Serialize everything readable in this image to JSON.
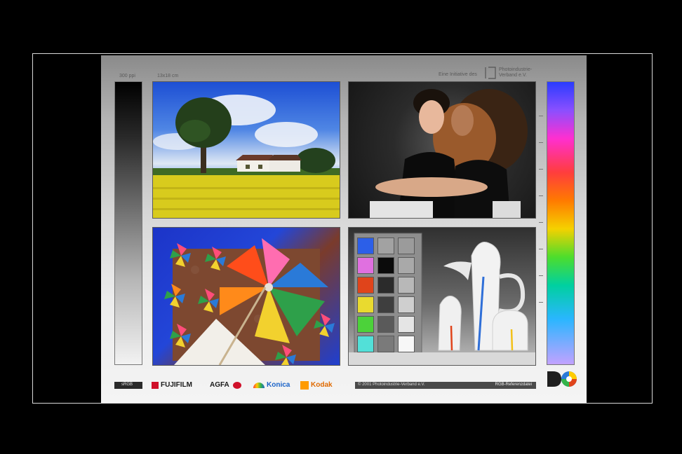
{
  "chart_labels": {
    "ppi": "300 ppi",
    "size": "13x18 cm",
    "initiative": "Eine Initiative des",
    "org_line1": "Photoindustrie-",
    "org_line2": "Verband e.V.",
    "srgb": "sRGB",
    "copyright": "© 2001 Photoindustrie-Verband e.V.",
    "reference": "RGB-Referenzdatei"
  },
  "brands": {
    "fujifilm": "FUJIFILM",
    "agfa": "AGFA",
    "konica": "Konica",
    "kodak": "Kodak"
  },
  "colors": {
    "fujifilm": "#1a1a1a",
    "agfa": "#d0102a",
    "konica": "#1a63c8",
    "kodak": "#ff9b00"
  },
  "chips": {
    "left": [
      "#2c5fe8",
      "#e070e0",
      "#e0441b",
      "#e9da2f",
      "#4cd23a",
      "#52e0d8"
    ],
    "mid": [
      "#a2a2a2",
      "#0b0b0b",
      "#2b2b2b",
      "#3e3e3e",
      "#5a5a5a",
      "#7a7a7a"
    ],
    "right": [
      "#9b9b9b",
      "#a9a9a9",
      "#b8b8b8",
      "#cfcfcf",
      "#e5e5e5",
      "#f7f7f7"
    ]
  }
}
